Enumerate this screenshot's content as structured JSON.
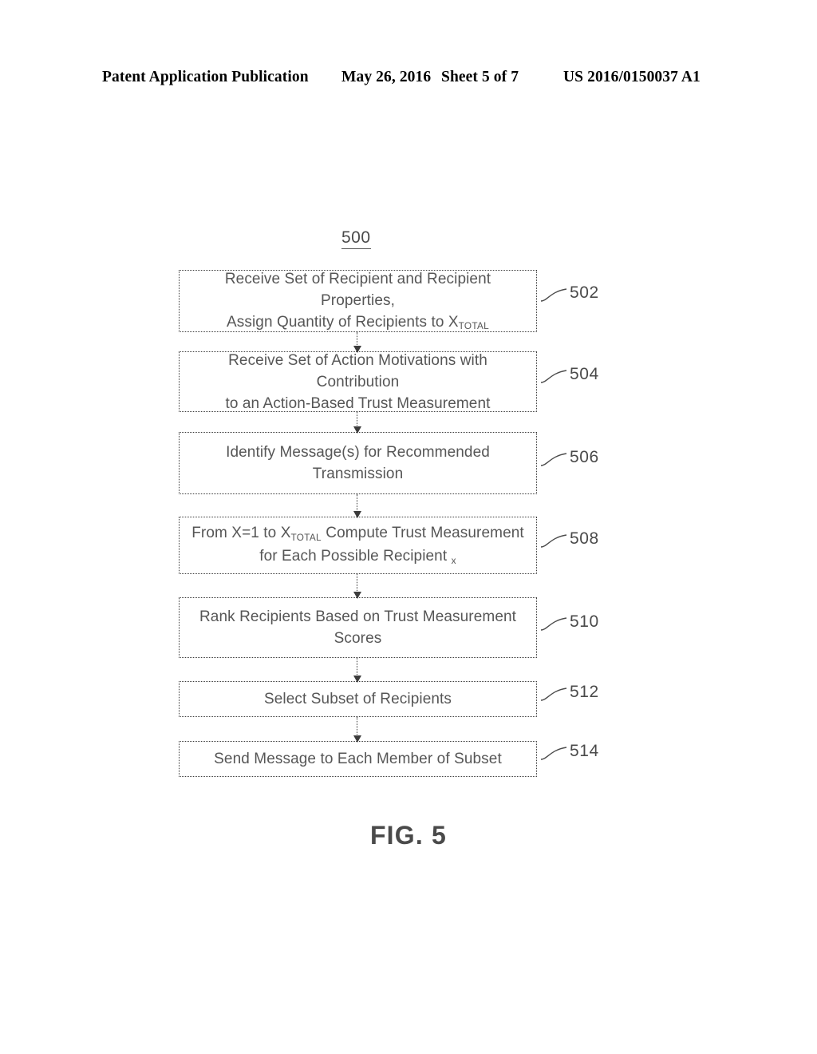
{
  "header": {
    "left": "Patent Application Publication",
    "date": "May 26, 2016",
    "sheet": "Sheet 5 of 7",
    "pub_number": "US 2016/0150037 A1"
  },
  "figure": {
    "id_label": "500",
    "caption": "FIG. 5"
  },
  "flowchart": {
    "type": "flowchart",
    "orientation": "top-to-bottom",
    "connector_style": "dotted-arrow",
    "box_style": "dotted-rectangle",
    "nodes": [
      {
        "ref": "502",
        "text_lines": [
          "Receive Set of Recipient and Recipient Properties,",
          "Assign Quantity of Recipients to X"
        ],
        "subscript": "TOTAL",
        "plain_text": "Receive Set of Recipient and Recipient Properties, Assign Quantity of Recipients to XTOTAL"
      },
      {
        "ref": "504",
        "text_lines": [
          "Receive Set of Action Motivations with Contribution",
          "to an Action-Based Trust Measurement"
        ],
        "plain_text": "Receive Set of Action Motivations with Contribution to an Action-Based Trust Measurement"
      },
      {
        "ref": "506",
        "text_lines": [
          "Identify Message(s) for Recommended",
          "Transmission"
        ],
        "plain_text": "Identify Message(s) for Recommended Transmission"
      },
      {
        "ref": "508",
        "text_lines": [
          "From X=1 to X",
          "Compute Trust Measurement",
          "for Each Possible Recipient"
        ],
        "subscript_1": "TOTAL",
        "subscript_2": "x",
        "plain_text": "From X=1 to XTOTAL Compute Trust Measurement for Each Possible Recipient x"
      },
      {
        "ref": "510",
        "text_lines": [
          "Rank Recipients Based on Trust Measurement",
          "Scores"
        ],
        "plain_text": "Rank Recipients Based on Trust Measurement Scores"
      },
      {
        "ref": "512",
        "text_lines": [
          "Select Subset of Recipients"
        ],
        "plain_text": "Select Subset of Recipients"
      },
      {
        "ref": "514",
        "text_lines": [
          "Send Message to Each Member of Subset"
        ],
        "plain_text": "Send Message to Each Member of Subset"
      }
    ]
  },
  "colors": {
    "line": "#3c3c3c",
    "text": "#565656",
    "header_text": "#000000",
    "background": "#ffffff"
  }
}
